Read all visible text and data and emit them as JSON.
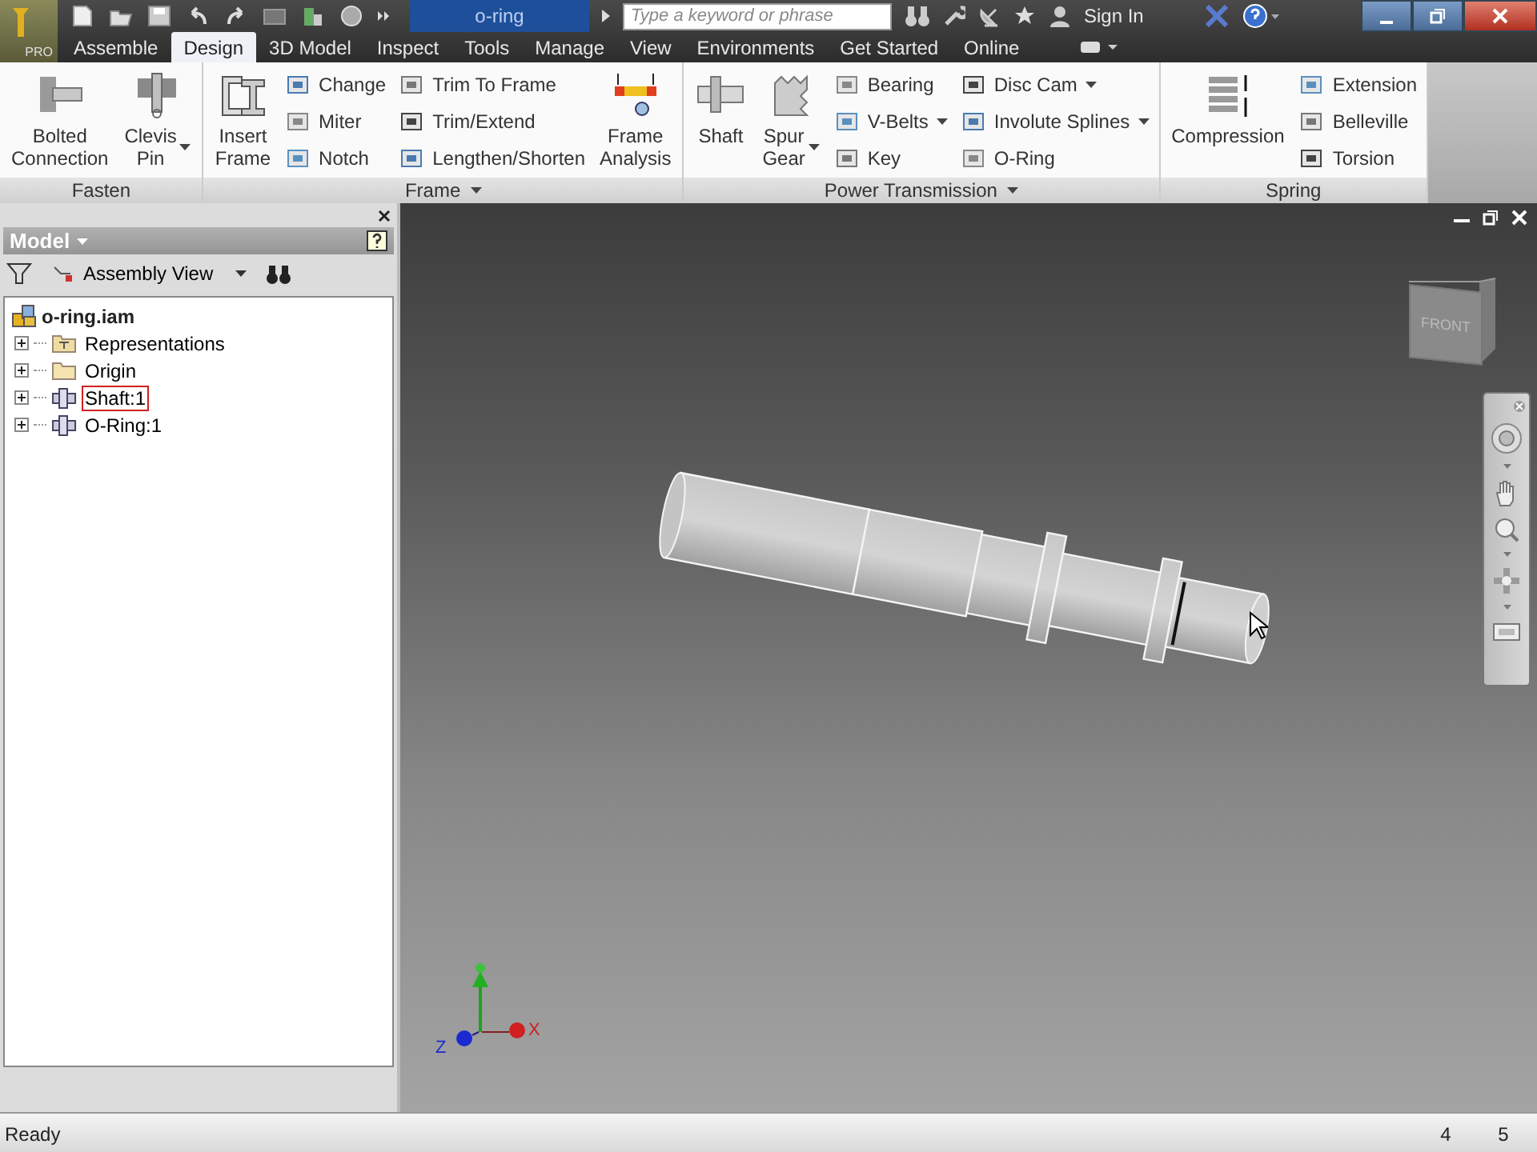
{
  "app_button": {
    "label": "PRO"
  },
  "document_title": "o-ring",
  "search": {
    "placeholder": "Type a keyword or phrase"
  },
  "sign_in": "Sign In",
  "tabs": [
    {
      "label": "Assemble",
      "selected": false
    },
    {
      "label": "Design",
      "selected": true
    },
    {
      "label": "3D Model",
      "selected": false
    },
    {
      "label": "Inspect",
      "selected": false
    },
    {
      "label": "Tools",
      "selected": false
    },
    {
      "label": "Manage",
      "selected": false
    },
    {
      "label": "View",
      "selected": false
    },
    {
      "label": "Environments",
      "selected": false
    },
    {
      "label": "Get Started",
      "selected": false
    },
    {
      "label": "Online",
      "selected": false
    }
  ],
  "ribbon": [
    {
      "title": "Fasten",
      "menu": false,
      "groups": [
        {
          "kind": "large",
          "tools": [
            {
              "label": "Bolted Connection",
              "dropdown": false
            },
            {
              "label": "Clevis Pin",
              "dropdown": true
            }
          ]
        }
      ]
    },
    {
      "title": "Frame",
      "menu": true,
      "groups": [
        {
          "kind": "large",
          "tools": [
            {
              "label": "Insert Frame",
              "dropdown": false
            }
          ]
        },
        {
          "kind": "stack",
          "tools": [
            {
              "label": "Change",
              "dropdown": false
            },
            {
              "label": "Miter",
              "dropdown": false
            },
            {
              "label": "Notch",
              "dropdown": false
            }
          ]
        },
        {
          "kind": "stack",
          "tools": [
            {
              "label": "Trim To Frame",
              "dropdown": false
            },
            {
              "label": "Trim/Extend",
              "dropdown": false
            },
            {
              "label": "Lengthen/Shorten",
              "dropdown": false
            }
          ]
        },
        {
          "kind": "large",
          "tools": [
            {
              "label": "Frame Analysis",
              "dropdown": false
            }
          ]
        }
      ]
    },
    {
      "title": "Power Transmission",
      "menu": true,
      "groups": [
        {
          "kind": "large",
          "tools": [
            {
              "label": "Shaft",
              "dropdown": false
            },
            {
              "label": "Spur Gear",
              "dropdown": true
            }
          ]
        },
        {
          "kind": "stack",
          "tools": [
            {
              "label": "Bearing",
              "dropdown": false
            },
            {
              "label": "V-Belts",
              "dropdown": true
            },
            {
              "label": "Key",
              "dropdown": false
            }
          ]
        },
        {
          "kind": "stack",
          "tools": [
            {
              "label": "Disc Cam",
              "dropdown": true
            },
            {
              "label": "Involute Splines",
              "dropdown": true
            },
            {
              "label": "O-Ring",
              "dropdown": false
            }
          ]
        }
      ]
    },
    {
      "title": "Spring",
      "menu": false,
      "groups": [
        {
          "kind": "large",
          "tools": [
            {
              "label": "Compression",
              "dropdown": false
            }
          ]
        },
        {
          "kind": "stack",
          "tools": [
            {
              "label": "Extension",
              "dropdown": false
            },
            {
              "label": "Belleville",
              "dropdown": false
            },
            {
              "label": "Torsion",
              "dropdown": false
            }
          ]
        }
      ]
    }
  ],
  "browser": {
    "title": "Model",
    "view": "Assembly View",
    "tree": {
      "label": "o-ring.iam",
      "children": [
        {
          "label": "Representations",
          "kind": "representations",
          "expanded": false,
          "selected": false
        },
        {
          "label": "Origin",
          "kind": "folder",
          "expanded": false,
          "selected": false
        },
        {
          "label": "Shaft:1",
          "kind": "part",
          "expanded": false,
          "selected": true
        },
        {
          "label": "O-Ring:1",
          "kind": "part",
          "expanded": false,
          "selected": false
        }
      ]
    }
  },
  "viewport": {
    "view_cube": "FRONT",
    "axes": [
      {
        "label": "X",
        "color": "#d02020"
      },
      {
        "label": "Z",
        "color": "#1a2ad0"
      }
    ]
  },
  "status_bar": {
    "message": "Ready",
    "fields": [
      "4",
      "5"
    ]
  }
}
